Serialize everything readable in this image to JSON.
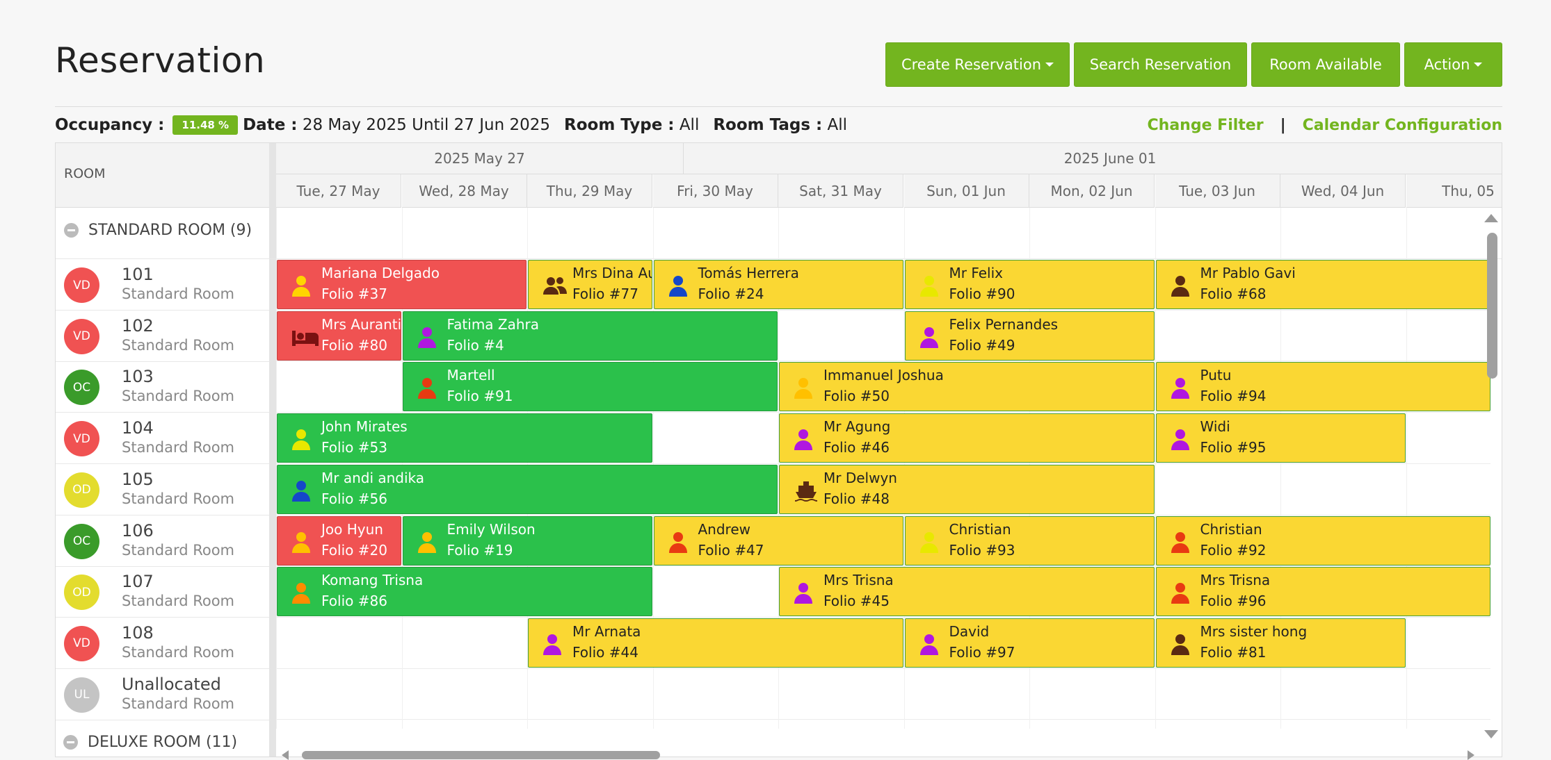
{
  "page": {
    "title": "Reservation"
  },
  "toolbar": {
    "create_label": "Create Reservation",
    "search_label": "Search Reservation",
    "available_label": "Room Available",
    "action_label": "Action"
  },
  "filters": {
    "occupancy_label": "Occupancy :",
    "occupancy_value": "11.48 %",
    "date_label": "Date :",
    "date_value": "28 May 2025 Until 27 Jun 2025",
    "room_type_label": "Room Type :",
    "room_type_value": "All",
    "room_tags_label": "Room Tags :",
    "room_tags_value": "All",
    "change_filter": "Change Filter",
    "separator": "|",
    "calendar_config": "Calendar Configuration"
  },
  "calendar": {
    "room_header": "ROOM",
    "months": [
      "2025 May 27",
      "2025 June 01"
    ],
    "days": [
      "Tue, 27 May",
      "Wed, 28 May",
      "Thu, 29 May",
      "Fri, 30 May",
      "Sat, 31 May",
      "Sun, 01 Jun",
      "Mon, 02 Jun",
      "Tue, 03 Jun",
      "Wed, 04 Jun",
      "Thu, 05"
    ],
    "group": "STANDARD ROOM (9)",
    "next_group": "DELUXE ROOM (11)",
    "rooms": [
      {
        "code": "VD",
        "number": "101",
        "type": "Standard Room",
        "color": "#f05252"
      },
      {
        "code": "VD",
        "number": "102",
        "type": "Standard Room",
        "color": "#f05252"
      },
      {
        "code": "OC",
        "number": "103",
        "type": "Standard Room",
        "color": "#3a9b2a"
      },
      {
        "code": "VD",
        "number": "104",
        "type": "Standard Room",
        "color": "#f05252"
      },
      {
        "code": "OD",
        "number": "105",
        "type": "Standard Room",
        "color": "#e3dc2e"
      },
      {
        "code": "OC",
        "number": "106",
        "type": "Standard Room",
        "color": "#3a9b2a"
      },
      {
        "code": "OD",
        "number": "107",
        "type": "Standard Room",
        "color": "#e3dc2e"
      },
      {
        "code": "VD",
        "number": "108",
        "type": "Standard Room",
        "color": "#f05252"
      },
      {
        "code": "UL",
        "number": "Unallocated",
        "type": "Standard Room",
        "color": "#c4c4c4"
      }
    ],
    "bookings": [
      {
        "row": 0,
        "start": 0,
        "len": 2,
        "color": "red",
        "icon": "person",
        "icon_color": "#ffd400",
        "name": "Mariana Delgado",
        "folio": "Folio #37"
      },
      {
        "row": 0,
        "start": 2,
        "len": 1,
        "color": "yellow",
        "icon": "group",
        "icon_color": "#5a2a12",
        "name": "Mrs Dina Aulia",
        "folio": "Folio #77"
      },
      {
        "row": 0,
        "start": 3,
        "len": 2,
        "color": "yellow",
        "icon": "person",
        "icon_color": "#1547c9",
        "name": "Tomás Herrera",
        "folio": "Folio #24"
      },
      {
        "row": 0,
        "start": 5,
        "len": 2,
        "color": "yellow",
        "icon": "person",
        "icon_color": "#e8e800",
        "name": "Mr Felix",
        "folio": "Folio #90"
      },
      {
        "row": 0,
        "start": 7,
        "len": 3,
        "color": "yellow",
        "icon": "person",
        "icon_color": "#5a2a12",
        "name": "Mr Pablo Gavi",
        "folio": "Folio #68"
      },
      {
        "row": 1,
        "start": 0,
        "len": 1,
        "color": "red",
        "icon": "bed",
        "icon_color": "#7a1111",
        "name": "Mrs Auranti diana",
        "folio": "Folio #80"
      },
      {
        "row": 1,
        "start": 1,
        "len": 3,
        "color": "green",
        "icon": "person",
        "icon_color": "#b017e0",
        "name": "Fatima Zahra",
        "folio": "Folio #4"
      },
      {
        "row": 1,
        "start": 5,
        "len": 2,
        "color": "yellow",
        "icon": "person",
        "icon_color": "#b017e0",
        "name": "Felix Pernandes",
        "folio": "Folio #49"
      },
      {
        "row": 2,
        "start": 1,
        "len": 3,
        "color": "green",
        "icon": "person",
        "icon_color": "#e83a12",
        "name": "Martell",
        "folio": "Folio #91"
      },
      {
        "row": 2,
        "start": 4,
        "len": 3,
        "color": "yellow",
        "icon": "person",
        "icon_color": "#ffc000",
        "name": "Immanuel Joshua",
        "folio": "Folio #50"
      },
      {
        "row": 2,
        "start": 7,
        "len": 3,
        "color": "yellow",
        "icon": "person",
        "icon_color": "#b017e0",
        "name": "Putu",
        "folio": "Folio #94"
      },
      {
        "row": 3,
        "start": 0,
        "len": 3,
        "color": "green",
        "icon": "person",
        "icon_color": "#e8e800",
        "name": "John Mirates",
        "folio": "Folio #53"
      },
      {
        "row": 3,
        "start": 4,
        "len": 3,
        "color": "yellow",
        "icon": "person",
        "icon_color": "#b017e0",
        "name": "Mr Agung",
        "folio": "Folio #46"
      },
      {
        "row": 3,
        "start": 7,
        "len": 2,
        "color": "yellow",
        "icon": "person",
        "icon_color": "#b017e0",
        "name": "Widi",
        "folio": "Folio #95"
      },
      {
        "row": 4,
        "start": 0,
        "len": 4,
        "color": "green",
        "icon": "person",
        "icon_color": "#1547c9",
        "name": "Mr andi andika",
        "folio": "Folio #56"
      },
      {
        "row": 4,
        "start": 4,
        "len": 3,
        "color": "yellow",
        "icon": "ship",
        "icon_color": "#5a2a12",
        "name": "Mr Delwyn",
        "folio": "Folio #48"
      },
      {
        "row": 5,
        "start": 0,
        "len": 1,
        "color": "red",
        "icon": "person",
        "icon_color": "#ffc000",
        "name": "Joo Hyun",
        "folio": "Folio #20"
      },
      {
        "row": 5,
        "start": 1,
        "len": 2,
        "color": "green",
        "icon": "person",
        "icon_color": "#ffc000",
        "name": "Emily Wilson",
        "folio": "Folio #19"
      },
      {
        "row": 5,
        "start": 3,
        "len": 2,
        "color": "yellow",
        "icon": "person",
        "icon_color": "#e83a12",
        "name": "Andrew",
        "folio": "Folio #47"
      },
      {
        "row": 5,
        "start": 5,
        "len": 2,
        "color": "yellow",
        "icon": "person",
        "icon_color": "#e8e800",
        "name": "Christian",
        "folio": "Folio #93"
      },
      {
        "row": 5,
        "start": 7,
        "len": 3,
        "color": "yellow",
        "icon": "person",
        "icon_color": "#e83a12",
        "name": "Christian",
        "folio": "Folio #92"
      },
      {
        "row": 6,
        "start": 0,
        "len": 3,
        "color": "green",
        "icon": "person",
        "icon_color": "#ff8c00",
        "name": "Komang Trisna",
        "folio": "Folio #86"
      },
      {
        "row": 6,
        "start": 4,
        "len": 3,
        "color": "yellow",
        "icon": "person",
        "icon_color": "#b017e0",
        "name": "Mrs Trisna",
        "folio": "Folio #45"
      },
      {
        "row": 6,
        "start": 7,
        "len": 3,
        "color": "yellow",
        "icon": "person",
        "icon_color": "#e83a12",
        "name": "Mrs Trisna",
        "folio": "Folio #96"
      },
      {
        "row": 7,
        "start": 2,
        "len": 3,
        "color": "yellow",
        "icon": "person",
        "icon_color": "#b017e0",
        "name": "Mr Arnata",
        "folio": "Folio #44"
      },
      {
        "row": 7,
        "start": 5,
        "len": 2,
        "color": "yellow",
        "icon": "person",
        "icon_color": "#b017e0",
        "name": "David",
        "folio": "Folio #97"
      },
      {
        "row": 7,
        "start": 7,
        "len": 2,
        "color": "yellow",
        "icon": "person",
        "icon_color": "#5a2a12",
        "name": "Mrs sister hong",
        "folio": "Folio #81"
      }
    ]
  }
}
